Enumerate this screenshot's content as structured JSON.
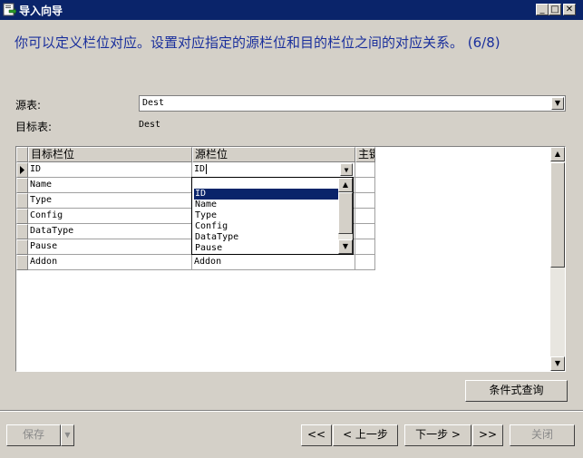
{
  "window": {
    "title": "导入向导",
    "minimize": "_",
    "maximize": "□",
    "close": "✕"
  },
  "heading": "你可以定义栏位对应。设置对应指定的源栏位和目的栏位之间的对应关系。 (6/8)",
  "source": {
    "label": "源表:",
    "value": "Dest"
  },
  "target": {
    "label": "目标表:",
    "value": "Dest"
  },
  "grid": {
    "columns": [
      "目标栏位",
      "源栏位",
      "主键"
    ],
    "rows": [
      {
        "target": "ID",
        "source": "ID"
      },
      {
        "target": "Name",
        "source": ""
      },
      {
        "target": "Type",
        "source": ""
      },
      {
        "target": "Config",
        "source": ""
      },
      {
        "target": "DataType",
        "source": ""
      },
      {
        "target": "Pause",
        "source": ""
      },
      {
        "target": "Addon",
        "source": "Addon"
      }
    ]
  },
  "dropdown": {
    "items": [
      "ID",
      "Name",
      "Type",
      "Config",
      "DataType",
      "Pause"
    ],
    "selected": "ID"
  },
  "buttons": {
    "conditional_query": "条件式查询",
    "save": "保存",
    "first": "<<",
    "prev": "< 上一步",
    "next": "下一步 >",
    "last": ">>",
    "close": "关闭"
  }
}
